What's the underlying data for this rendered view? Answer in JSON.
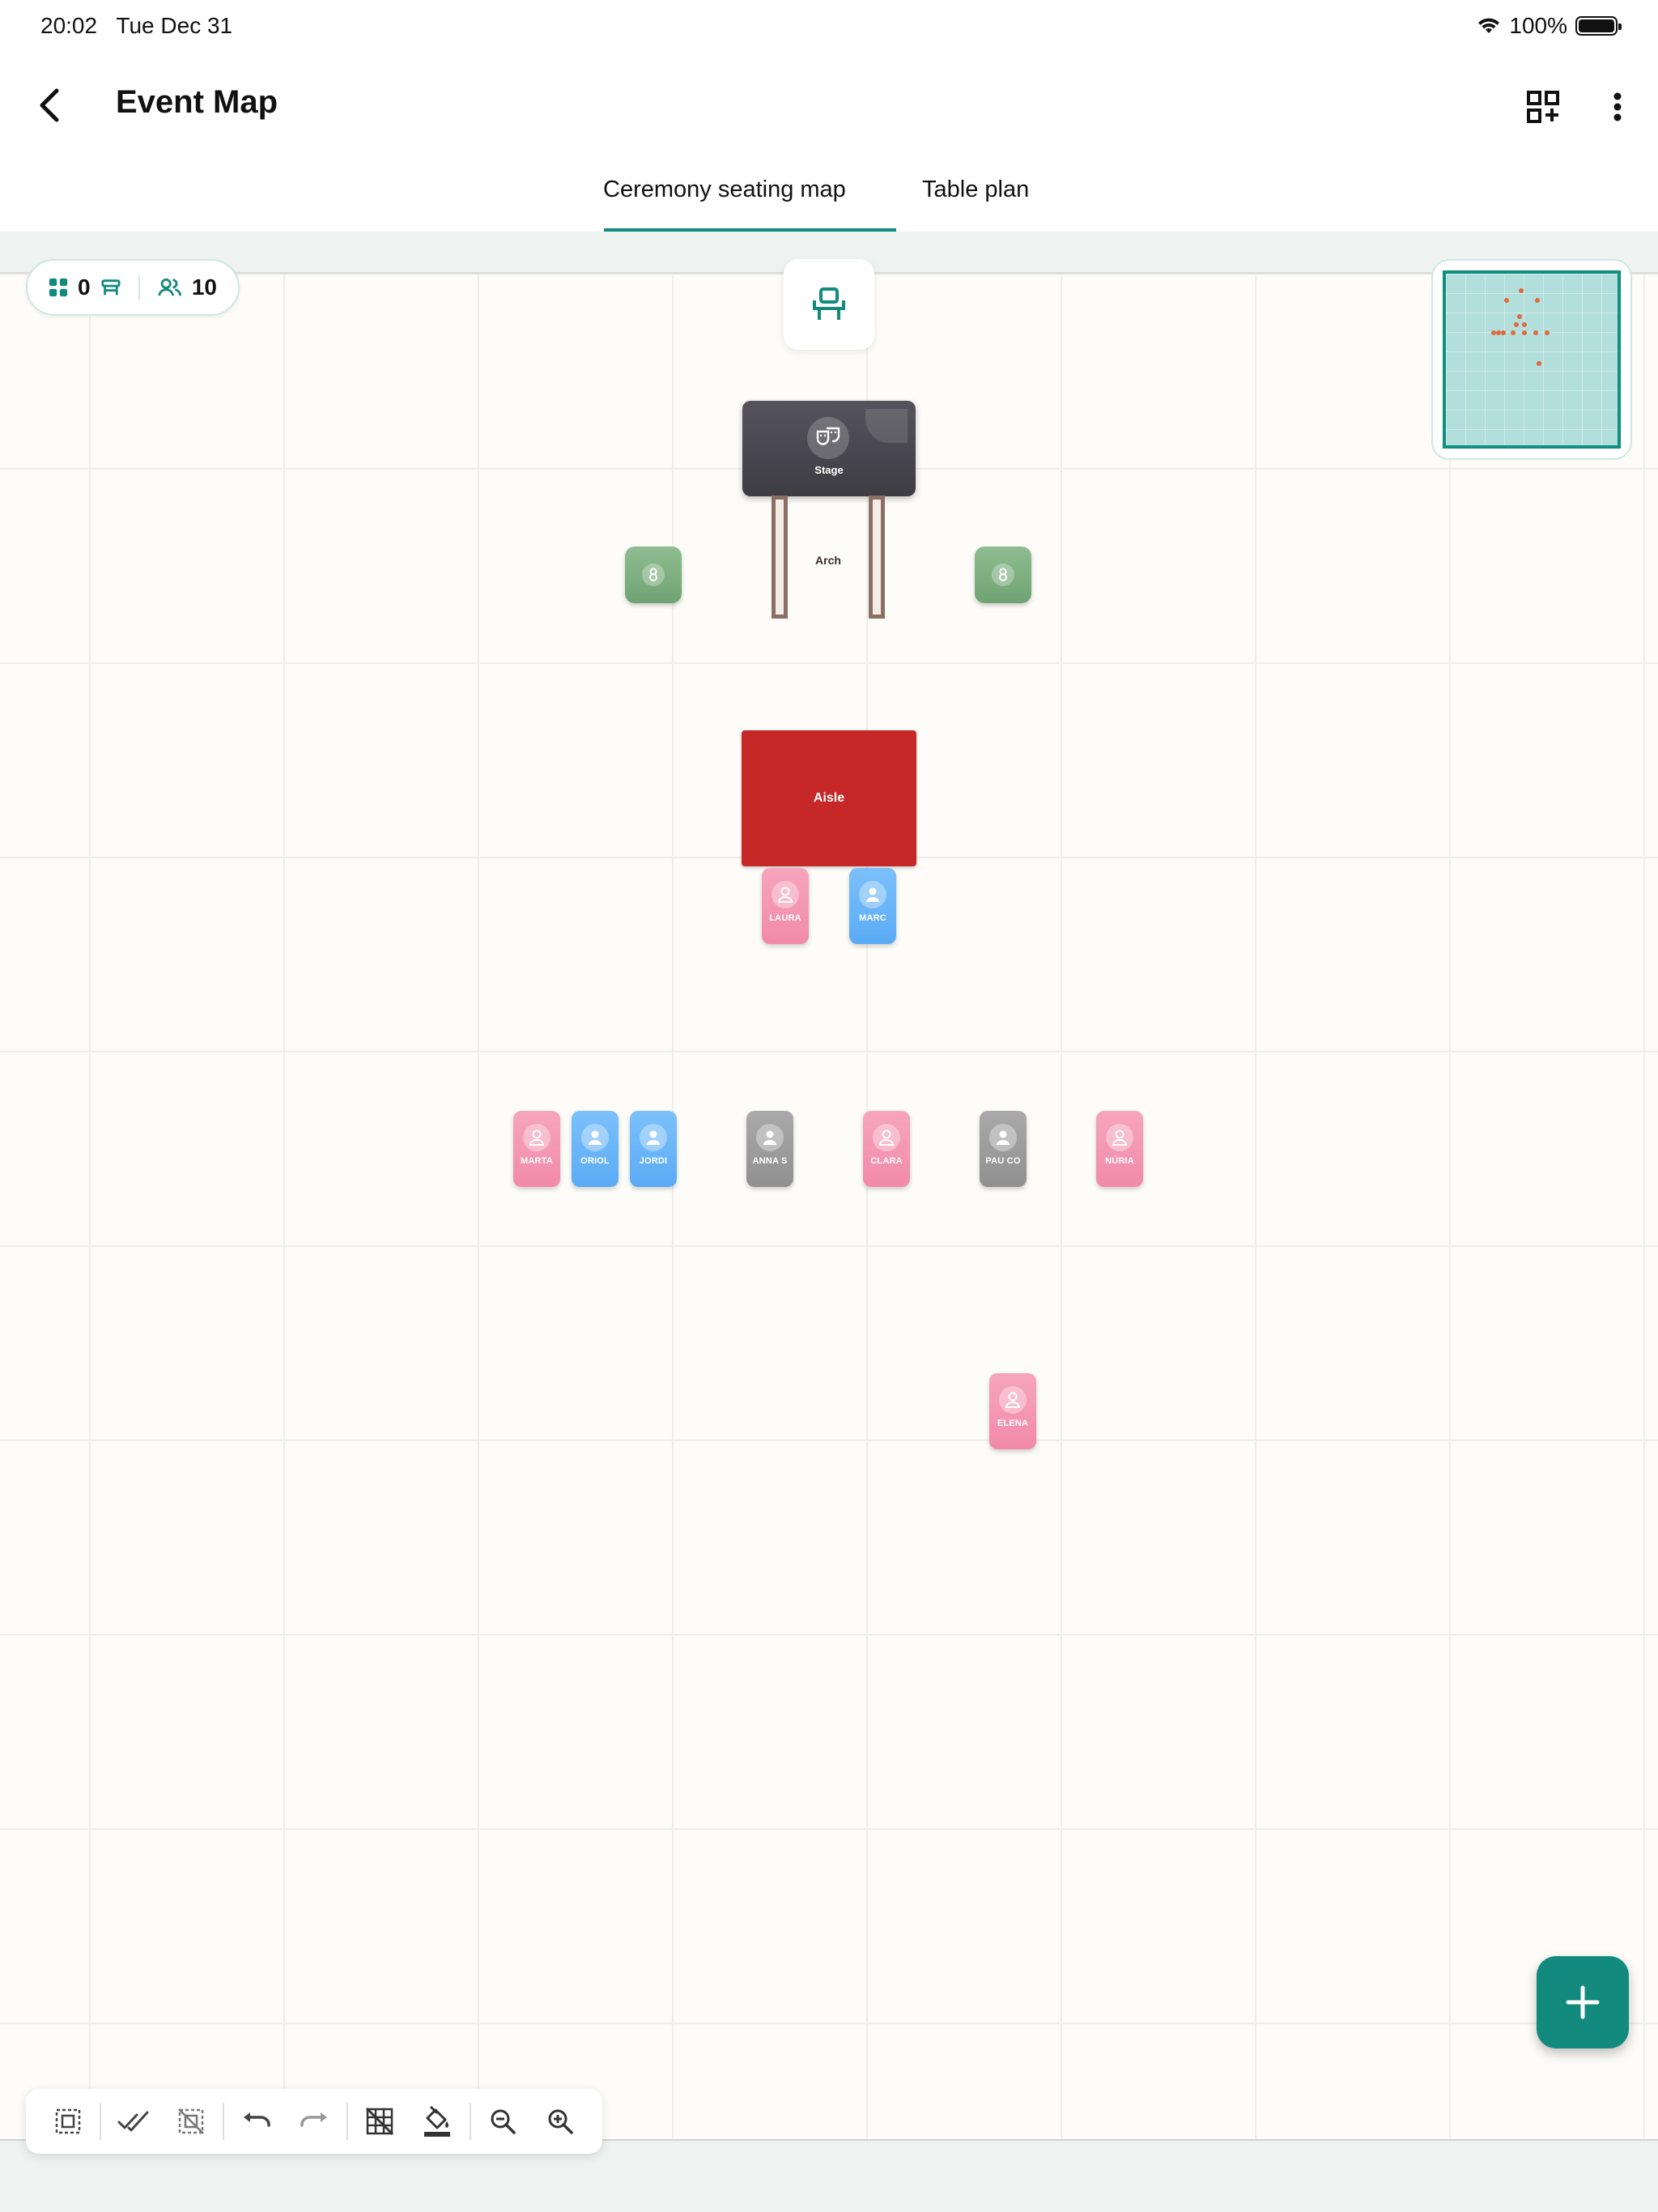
{
  "status_bar": {
    "time": "20:02",
    "date": "Tue Dec 31",
    "battery": "100%"
  },
  "header": {
    "title": "Event Map"
  },
  "tabs": [
    {
      "label": "Ceremony seating map",
      "active": true
    },
    {
      "label": "Table plan",
      "active": false
    }
  ],
  "counters": {
    "tables": "0",
    "guests": "10"
  },
  "map": {
    "stage_label": "Stage",
    "arch_label": "Arch",
    "aisle_label": "Aisle",
    "seats": [
      {
        "name": "LAURA",
        "color": "pink"
      },
      {
        "name": "MARC",
        "color": "blue"
      },
      {
        "name": "MARTA",
        "color": "pink"
      },
      {
        "name": "ORIOL",
        "color": "blue"
      },
      {
        "name": "JORDI",
        "color": "blue"
      },
      {
        "name": "ANNA S",
        "color": "grey"
      },
      {
        "name": "CLARA",
        "color": "pink"
      },
      {
        "name": "PAU CO",
        "color": "grey"
      },
      {
        "name": "NÚRIA",
        "color": "pink"
      },
      {
        "name": "ELENA",
        "color": "pink"
      }
    ]
  },
  "colors": {
    "accent": "#128a7e",
    "stage": "#46454c",
    "aisle": "#c62828",
    "plant": "#7fb081",
    "pink_seat": "#f49ab4",
    "blue_seat": "#6ab6f8",
    "grey_seat": "#9e9e9e"
  },
  "toolbar": {
    "tools": [
      "select-area-icon",
      "select-all-icon",
      "deselect-icon",
      "undo-icon",
      "redo-icon",
      "grid-off-icon",
      "fill-color-icon",
      "zoom-out-icon",
      "zoom-in-icon"
    ]
  }
}
